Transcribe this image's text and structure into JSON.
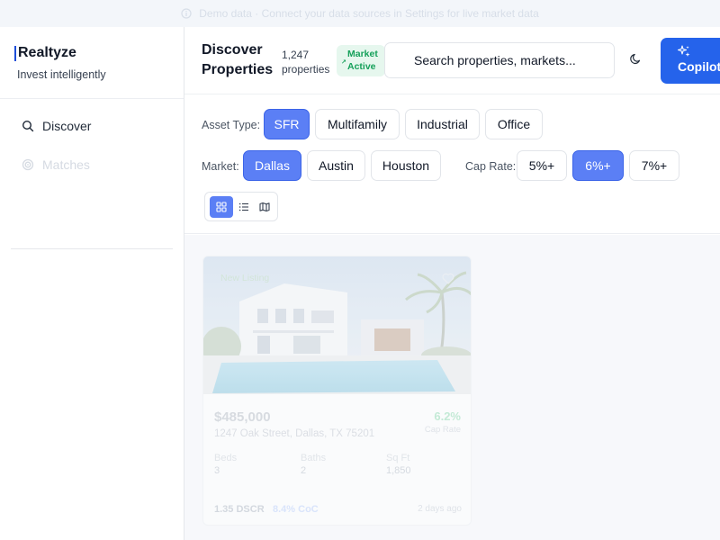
{
  "banner": {
    "text": "Demo data · Connect your data sources in Settings for live market data"
  },
  "sidebar": {
    "brand": "Realtyze",
    "tagline": "Invest intelligently",
    "items": [
      {
        "label": "Discover",
        "icon": "search-icon"
      },
      {
        "label": "Matches",
        "icon": "target-icon"
      }
    ]
  },
  "header": {
    "title": "Discover Properties",
    "count": "1,247 properties",
    "badge": "Market Active",
    "search_placeholder": "Search properties, markets...",
    "copilot_label": "Copilot"
  },
  "filters": {
    "asset_type_label": "Asset Type:",
    "asset_types": [
      "SFR",
      "Multifamily",
      "Industrial",
      "Office"
    ],
    "asset_type_selected": "SFR",
    "market_label": "Market:",
    "markets": [
      "Dallas",
      "Austin",
      "Houston"
    ],
    "market_selected": "Dallas",
    "cap_rate_label": "Cap Rate:",
    "cap_rates": [
      "5%+",
      "6%+",
      "7%+"
    ],
    "cap_rate_selected": "6%+",
    "view_modes": [
      "grid",
      "list",
      "map"
    ],
    "view_selected": "grid"
  },
  "listing": {
    "tag": "New Listing",
    "price": "$485,000",
    "address": "1247 Oak Street, Dallas, TX 75201",
    "cap_rate": "6.2%",
    "cap_rate_label": "Cap Rate",
    "beds_label": "Beds",
    "beds": "3",
    "baths_label": "Baths",
    "baths": "2",
    "sqft_label": "Sq Ft",
    "sqft": "1,850",
    "dscr": "1.35 DSCR",
    "coc": "8.4% CoC",
    "posted": "2 days ago"
  },
  "colors": {
    "primary": "#2563eb",
    "chip_active": "#5b7ff5",
    "badge_bg": "#e6f7ee",
    "badge_text": "#15a05a"
  }
}
